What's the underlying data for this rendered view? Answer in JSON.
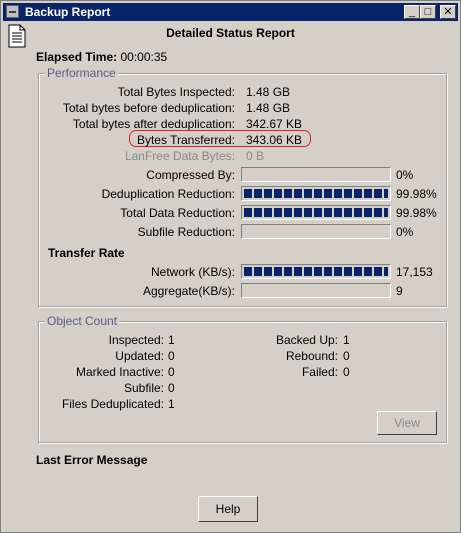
{
  "window": {
    "title": "Backup Report"
  },
  "header": {
    "title": "Detailed Status Report"
  },
  "elapsed": {
    "label": "Elapsed Time:",
    "value": "00:00:35"
  },
  "performance": {
    "legend": "Performance",
    "rows": [
      {
        "label": "Total Bytes Inspected:",
        "value": "1.48 GB"
      },
      {
        "label": "Total bytes before deduplication:",
        "value": "1.48 GB"
      },
      {
        "label": "Total bytes after deduplication:",
        "value": "342.67 KB"
      },
      {
        "label": "Bytes Transferred:",
        "value": "343.06 KB"
      },
      {
        "label": "LanFree Data Bytes:",
        "value": "0  B"
      }
    ],
    "bars": [
      {
        "label": "Compressed By:",
        "value": "0%",
        "level": 0.0
      },
      {
        "label": "Deduplication Reduction:",
        "value": "99.98%",
        "level": 0.9998
      },
      {
        "label": "Total Data Reduction:",
        "value": "99.98%",
        "level": 0.9998
      },
      {
        "label": "Subfile Reduction:",
        "value": "0%",
        "level": 0.0
      }
    ],
    "transfer_rate": {
      "heading": "Transfer Rate",
      "rows": [
        {
          "label": "Network (KB/s):",
          "value": "17,153",
          "level": 1.0
        },
        {
          "label": "Aggregate(KB/s):",
          "value": "9",
          "level": 0.0
        }
      ]
    }
  },
  "object_count": {
    "legend": "Object Count",
    "left": [
      {
        "label": "Inspected:",
        "value": "1"
      },
      {
        "label": "Updated:",
        "value": "0"
      },
      {
        "label": "Marked Inactive:",
        "value": "0"
      },
      {
        "label": "Subfile:",
        "value": "0"
      },
      {
        "label": "Files Deduplicated:",
        "value": "1"
      }
    ],
    "right": [
      {
        "label": "Backed Up:",
        "value": "1"
      },
      {
        "label": "Rebound:",
        "value": "0"
      },
      {
        "label": "Failed:",
        "value": "0"
      }
    ],
    "view_button": "View"
  },
  "last_error": {
    "heading": "Last Error Message"
  },
  "footer": {
    "help_button": "Help"
  },
  "colors": {
    "titlebar": "#0a246a",
    "bar_fill": "#0a246a",
    "highlight": "#e02020"
  },
  "icons": [
    "document-icon",
    "minimize-icon",
    "maximize-icon",
    "close-icon"
  ]
}
